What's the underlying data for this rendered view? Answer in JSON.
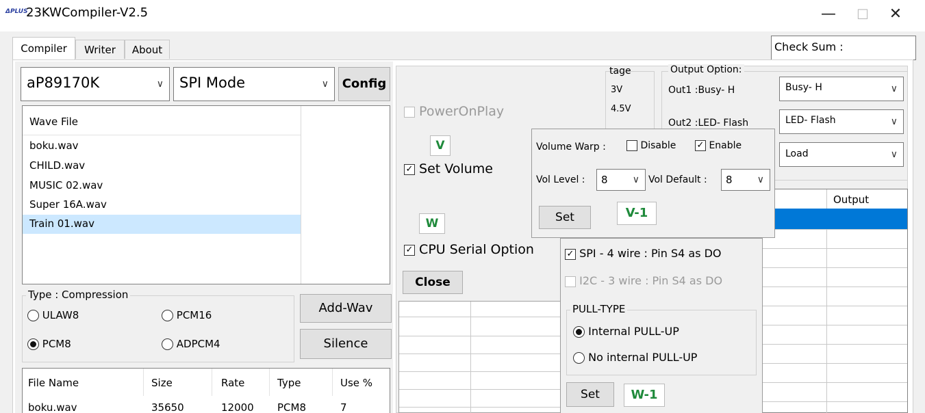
{
  "window": {
    "logo_text": "ΔPLUS",
    "title": "23KWCompiler-V2.5",
    "controls": {
      "minimize": "—",
      "maximize": "☐",
      "close": "✕"
    }
  },
  "tabs": [
    "Compiler",
    "Writer",
    "About"
  ],
  "checksum": {
    "label": "Check Sum :"
  },
  "chip_select": {
    "value": "aP89170K"
  },
  "mode_select": {
    "value": "SPI Mode"
  },
  "config_button": "Config",
  "wave_list": {
    "header": "Wave File",
    "items": [
      "boku.wav",
      "CHILD.wav",
      "MUSIC 02.wav",
      "Super 16A.wav",
      "Train 01.wav"
    ],
    "selected_index": 4
  },
  "compression": {
    "title": "Type : Compression",
    "options": [
      "ULAW8",
      "PCM16",
      "PCM8",
      "ADPCM4"
    ],
    "selected": "PCM8"
  },
  "add_wav_button": "Add-Wav",
  "silence_button": "Silence",
  "file_table": {
    "columns": [
      "File Name",
      "Size",
      "Rate",
      "Type",
      "Use %"
    ],
    "rows": [
      [
        "boku.wav",
        "35650",
        "12000",
        "PCM8",
        "7"
      ]
    ]
  },
  "options_panel": {
    "power_on_play": "PowerOnPlay",
    "set_volume": "Set Volume",
    "cpu_serial_option": "CPU Serial Option",
    "close_button": "Close",
    "label_v": "V",
    "label_w": "W"
  },
  "voltage_partial": {
    "title": "tage",
    "values": [
      "3V",
      "4.5V"
    ]
  },
  "output_option": {
    "title": "Output Option:",
    "out1_label": "Out1 :Busy- H",
    "out1_value": "Busy- H",
    "out2_label": "Out2 :LED- Flash",
    "out2_value": "LED- Flash",
    "out3_value": "Load"
  },
  "output_table": {
    "header": "Output"
  },
  "volume_popup": {
    "warp_label": "Volume Warp :",
    "disable": "Disable",
    "enable": "Enable",
    "vol_level_label": "Vol Level :",
    "vol_level_value": "8",
    "vol_default_label": "Vol Default :",
    "vol_default_value": "8",
    "set_button": "Set",
    "tag": "V-1"
  },
  "serial_popup": {
    "spi_option": "SPI - 4 wire : Pin S4 as DO",
    "i2c_option": "I2C - 3 wire : Pin S4 as DO",
    "pull_type_title": "PULL-TYPE",
    "pull_options": [
      "Internal PULL-UP",
      "No internal PULL-UP"
    ],
    "pull_selected": "Internal PULL-UP",
    "set_button": "Set",
    "tag": "W-1"
  }
}
